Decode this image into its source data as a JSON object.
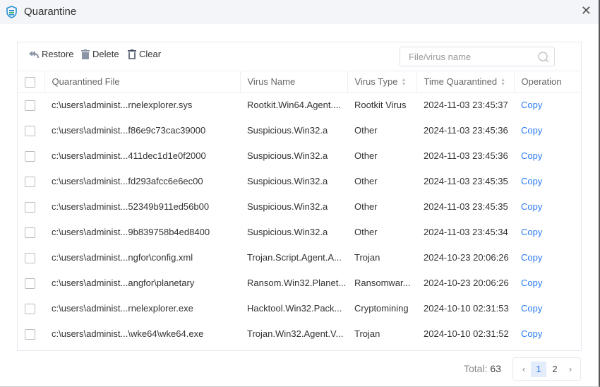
{
  "window": {
    "title": "Quarantine"
  },
  "toolbar": {
    "restore": "Restore",
    "delete": "Delete",
    "clear": "Clear",
    "search_placeholder": "File/virus name"
  },
  "columns": [
    "Quarantined File",
    "Virus Name",
    "Virus Type",
    "Time Quarantined",
    "Operation"
  ],
  "rows": [
    {
      "file": "c:\\users\\administ...rnelexplorer.sys",
      "virus": "Rootkit.Win64.Agent....",
      "type": "Rootkit Virus",
      "time": "2024-11-03 23:45:37",
      "op": "Copy"
    },
    {
      "file": "c:\\users\\administ...f86e9c73cac39000",
      "virus": "Suspicious.Win32.a",
      "type": "Other",
      "time": "2024-11-03 23:45:36",
      "op": "Copy"
    },
    {
      "file": "c:\\users\\administ...411dec1d1e0f2000",
      "virus": "Suspicious.Win32.a",
      "type": "Other",
      "time": "2024-11-03 23:45:36",
      "op": "Copy"
    },
    {
      "file": "c:\\users\\administ...fd293afcc6e6ec00",
      "virus": "Suspicious.Win32.a",
      "type": "Other",
      "time": "2024-11-03 23:45:35",
      "op": "Copy"
    },
    {
      "file": "c:\\users\\administ...52349b911ed56b00",
      "virus": "Suspicious.Win32.a",
      "type": "Other",
      "time": "2024-11-03 23:45:35",
      "op": "Copy"
    },
    {
      "file": "c:\\users\\administ...9b839758b4ed8400",
      "virus": "Suspicious.Win32.a",
      "type": "Other",
      "time": "2024-11-03 23:45:34",
      "op": "Copy"
    },
    {
      "file": "c:\\users\\administ...ngfor\\config.xml",
      "virus": "Trojan.Script.Agent.A...",
      "type": "Trojan",
      "time": "2024-10-23 20:06:26",
      "op": "Copy"
    },
    {
      "file": "c:\\users\\administ...angfor\\planetary",
      "virus": "Ransom.Win32.Planet...",
      "type": "Ransomwar...",
      "time": "2024-10-23 20:06:26",
      "op": "Copy"
    },
    {
      "file": "c:\\users\\administ...rnelexplorer.exe",
      "virus": "Hacktool.Win32.Pack...",
      "type": "Cryptomining",
      "time": "2024-10-10 02:31:53",
      "op": "Copy"
    },
    {
      "file": "c:\\users\\administ...\\wke64\\wke64.exe",
      "virus": "Trojan.Win32.Agent.V...",
      "type": "Trojan",
      "time": "2024-10-10 02:31:52",
      "op": "Copy"
    }
  ],
  "footer": {
    "total_label": "Total:",
    "total": "63",
    "pages": [
      "1",
      "2"
    ],
    "current_page": "1",
    "prev": "‹",
    "next": "›"
  },
  "colors": {
    "accent": "#2a7bf3",
    "titlebar": "#f3f5f9"
  }
}
